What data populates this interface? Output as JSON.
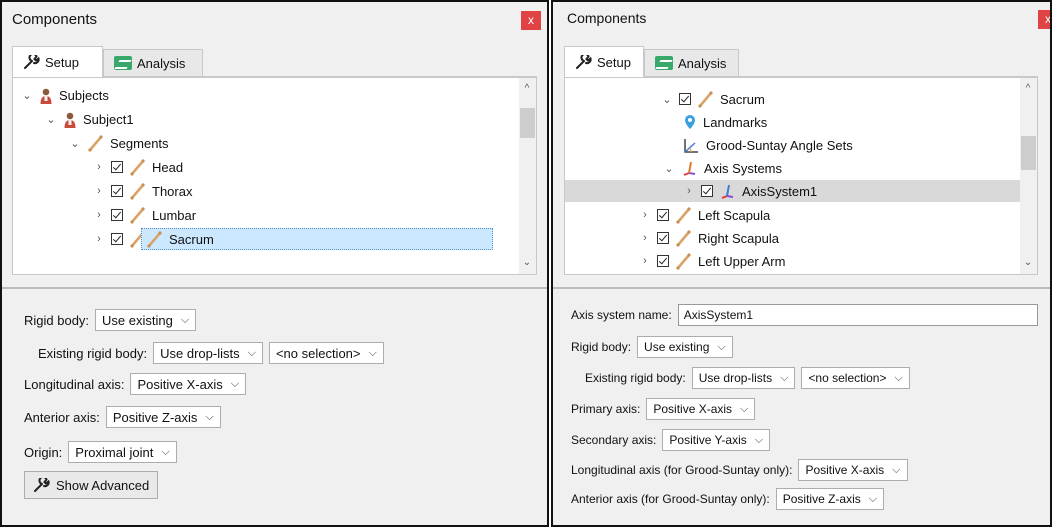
{
  "left_panel": {
    "title": "Components",
    "close_label": "x",
    "tabs": [
      {
        "label": "Setup"
      },
      {
        "label": "Analysis"
      }
    ],
    "tree": [
      {
        "label": "Subjects",
        "icon": "person-icon"
      },
      {
        "label": "Subject1",
        "icon": "person-icon"
      },
      {
        "label": "Segments",
        "icon": "bone-icon"
      },
      {
        "label": "Head",
        "icon": "bone-icon"
      },
      {
        "label": "Thorax",
        "icon": "bone-icon"
      },
      {
        "label": "Lumbar",
        "icon": "bone-icon"
      },
      {
        "label": "Sacrum",
        "icon": "bone-icon"
      }
    ],
    "form": {
      "rigid_body_label": "Rigid body:",
      "rigid_body_value": "Use existing",
      "existing_rigid_label": "Existing rigid body:",
      "existing_rigid_value": "Use drop-lists",
      "existing_selection": "<no selection>",
      "longitudinal_label": "Longitudinal axis:",
      "longitudinal_value": "Positive X-axis",
      "anterior_label": "Anterior axis:",
      "anterior_value": "Positive Z-axis",
      "origin_label": "Origin:",
      "origin_value": "Proximal joint",
      "show_advanced": "Show Advanced"
    }
  },
  "right_panel": {
    "title": "Components",
    "close_label": "x",
    "tabs": [
      {
        "label": "Setup"
      },
      {
        "label": "Analysis"
      }
    ],
    "tree": [
      {
        "label": "Sacrum",
        "icon": "bone-icon"
      },
      {
        "label": "Landmarks",
        "icon": "landmark-pin-icon"
      },
      {
        "label": "Grood-Suntay Angle Sets",
        "icon": "angle-set-icon"
      },
      {
        "label": "Axis Systems",
        "icon": "axis-system-icon"
      },
      {
        "label": "AxisSystem1",
        "icon": "axis-system-icon"
      },
      {
        "label": "Left Scapula",
        "icon": "bone-icon"
      },
      {
        "label": "Right Scapula",
        "icon": "bone-icon"
      },
      {
        "label": "Left Upper Arm",
        "icon": "bone-icon"
      }
    ],
    "form": {
      "axis_name_label": "Axis system name:",
      "axis_name_value": "AxisSystem1",
      "rigid_body_label": "Rigid body:",
      "rigid_body_value": "Use existing",
      "existing_rigid_label": "Existing rigid body:",
      "existing_rigid_value": "Use drop-lists",
      "existing_selection": "<no selection>",
      "primary_label": "Primary axis:",
      "primary_value": "Positive X-axis",
      "secondary_label": "Secondary axis:",
      "secondary_value": "Positive Y-axis",
      "long_gs_label": "Longitudinal axis (for Grood-Suntay only):",
      "long_gs_value": "Positive X-axis",
      "ant_gs_label": "Anterior axis (for Grood-Suntay only):",
      "ant_gs_value": "Positive Z-axis"
    }
  },
  "colors": {
    "close": "#e04343",
    "selection": "#cce8ff",
    "analysis_icon": "#39a86b",
    "bone": "#e0b27a",
    "landmark": "#3aa0e0",
    "axis": "#8a4fd0"
  }
}
